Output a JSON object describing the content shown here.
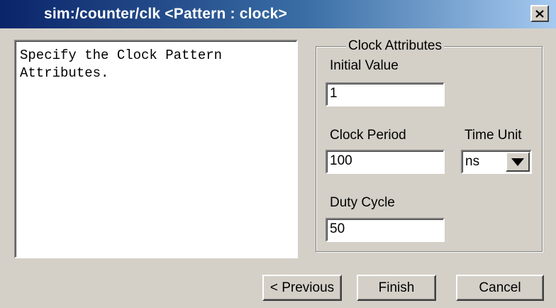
{
  "window": {
    "title": "sim:/counter/clk <Pattern : clock>",
    "close_icon": "close-icon"
  },
  "description": {
    "text": "Specify the Clock Pattern\nAttributes."
  },
  "clock_attributes": {
    "group_label": "Clock Attributes",
    "initial_value": {
      "label": "Initial Value",
      "value": "1"
    },
    "clock_period": {
      "label": "Clock Period",
      "value": "100"
    },
    "time_unit": {
      "label": "Time Unit",
      "selected": "ns",
      "dropdown_icon": "triangle-down-icon"
    },
    "duty_cycle": {
      "label": "Duty Cycle",
      "value": "50"
    }
  },
  "buttons": {
    "previous": "< Previous",
    "finish": "Finish",
    "cancel": "Cancel"
  },
  "colors": {
    "titlebar_start": "#0a246a",
    "titlebar_end": "#a6caf0",
    "face": "#d4d0c8"
  }
}
